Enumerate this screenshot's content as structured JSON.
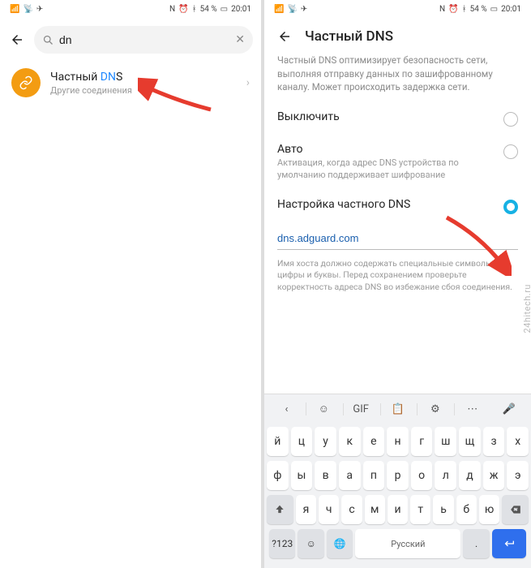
{
  "status": {
    "battery": "54 %",
    "time": "20:01",
    "bt_icon": "⚡",
    "nfc": "N"
  },
  "left": {
    "search_value": "dn",
    "result": {
      "title_prefix": "Частный ",
      "title_hl": "DN",
      "title_suffix": "S",
      "sub": "Другие соединения"
    }
  },
  "right": {
    "title": "Частный DNS",
    "desc": "Частный DNS оптимизирует безопасность сети, выполняя отправку данных по зашифрованному каналу. Может происходить задержка сети.",
    "opt_off": "Выключить",
    "opt_auto_title": "Авто",
    "opt_auto_sub": "Активация, когда адрес DNS устройства по умолчанию поддерживает шифрование",
    "opt_custom": "Настройка частного DNS",
    "dns_value": "dns.adguard.com",
    "hint": "Имя хоста должно содержать специальные символы, цифры и буквы. Перед сохранением проверьте корректность адреса DNS во избежание сбоя соединения."
  },
  "keyboard": {
    "gif": "GIF",
    "row1": [
      "й",
      "ц",
      "у",
      "к",
      "е",
      "н",
      "г",
      "ш",
      "щ",
      "з",
      "х"
    ],
    "row2": [
      "ф",
      "ы",
      "в",
      "а",
      "п",
      "р",
      "о",
      "л",
      "д",
      "ж",
      "э"
    ],
    "row3": [
      "я",
      "ч",
      "с",
      "м",
      "и",
      "т",
      "ь",
      "б",
      "ю"
    ],
    "num": "?123",
    "lang": "Русский",
    "dot": "."
  },
  "watermark": "24hitech.ru"
}
